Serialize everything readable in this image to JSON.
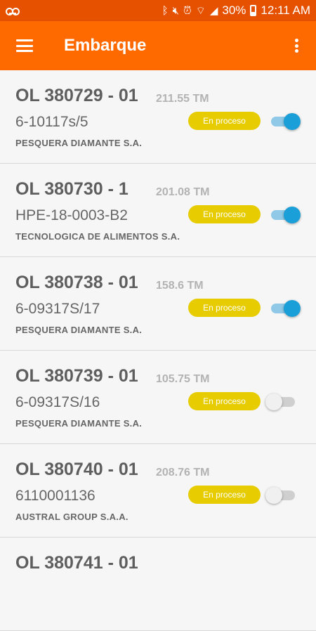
{
  "status_bar": {
    "battery": "30%",
    "time": "12:11 AM",
    "icons": [
      "voicemail-icon",
      "bluetooth-icon",
      "mute-icon",
      "alarm-icon",
      "wifi-icon",
      "signal-icon",
      "battery-icon"
    ]
  },
  "app_bar": {
    "title": "Embarque",
    "menu_icon": "hamburger-menu-icon",
    "more_icon": "more-vert-icon"
  },
  "colors": {
    "status_bar": "#e65100",
    "app_bar": "#ff6a00",
    "badge": "#e6cc00",
    "toggle_on": "#1b9fd8",
    "toggle_on_track": "#8fc9e7"
  },
  "shipments": [
    {
      "order": "OL 380729 - 01",
      "weight": "211.55 TM",
      "code": "6-10117s/5",
      "company": "PESQUERA DIAMANTE S.A.",
      "status": "En proceso",
      "enabled": true
    },
    {
      "order": "OL 380730 - 1",
      "weight": "201.08 TM",
      "code": "HPE-18-0003-B2",
      "company": "TECNOLOGICA DE ALIMENTOS S.A.",
      "status": "En proceso",
      "enabled": true
    },
    {
      "order": "OL 380738 - 01",
      "weight": "158.6 TM",
      "code": "6-09317S/17",
      "company": "PESQUERA DIAMANTE S.A.",
      "status": "En proceso",
      "enabled": true
    },
    {
      "order": "OL 380739 - 01",
      "weight": "105.75 TM",
      "code": "6-09317S/16",
      "company": "PESQUERA DIAMANTE S.A.",
      "status": "En proceso",
      "enabled": false
    },
    {
      "order": "OL 380740 - 01",
      "weight": "208.76 TM",
      "code": "6110001136",
      "company": "AUSTRAL GROUP S.A.A.",
      "status": "En proceso",
      "enabled": false
    },
    {
      "order": "OL 380741 - 01",
      "weight": "",
      "code": "",
      "company": "",
      "status": "",
      "enabled": false
    }
  ]
}
